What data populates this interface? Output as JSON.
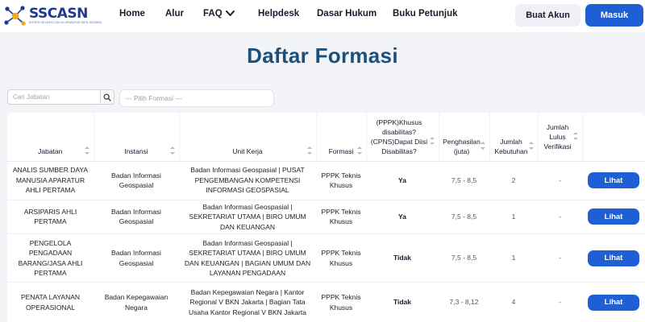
{
  "brand": {
    "name": "SSCASN",
    "tagline": "SISTEM SELEKSI CALON APARATUR SIPIL NEGARA",
    "colors": {
      "primary": "#1f5fd6",
      "title": "#1c4f7a",
      "logo": "#1f3a93",
      "accent": "#f2a81d"
    }
  },
  "nav": {
    "items": [
      "Home",
      "Alur",
      "FAQ",
      "Helpdesk",
      "Dasar Hukum",
      "Buku Petunjuk"
    ],
    "faq_icon": "chevron-down-icon",
    "buat_akun": "Buat Akun",
    "masuk": "Masuk"
  },
  "page": {
    "title": "Daftar Formasi"
  },
  "filters": {
    "search_placeholder": "Cari Jabatan",
    "search_icon": "search-icon",
    "select_placeholder": "--- Pilih Formasi ---"
  },
  "table": {
    "headers": [
      "Jabatan",
      "Instansi",
      "Unit Kerja",
      "Formasi",
      "(PPPK)Khusus disabilitas? (CPNS)Dapat Diisi Disabilitas?",
      "Penghasilan (juta)",
      "Jumlah Kebutuhan",
      "Jumlah Lulus Verifikasi",
      ""
    ],
    "rows": [
      {
        "jabatan": "ANALIS SUMBER DAYA MANUSIA APARATUR AHLI PERTAMA",
        "instansi": "Badan Informasi Geospasial",
        "unit_kerja": "Badan Informasi Geospasial | PUSAT PENGEMBANGAN KOMPETENSI INFORMASI GEOSPASIAL",
        "formasi": "PPPK Teknis Khusus",
        "disabilitas": "Ya",
        "penghasilan": "7,5 - 8,5",
        "kebutuhan": "2",
        "lulus": "-",
        "action": "Lihat"
      },
      {
        "jabatan": "ARSIPARIS AHLI PERTAMA",
        "instansi": "Badan Informasi Geospasial",
        "unit_kerja": "Badan Informasi Geospasial | SEKRETARIAT UTAMA | BIRO UMUM DAN KEUANGAN",
        "formasi": "PPPK Teknis Khusus",
        "disabilitas": "Ya",
        "penghasilan": "7,5 - 8,5",
        "kebutuhan": "1",
        "lulus": "-",
        "action": "Lihat"
      },
      {
        "jabatan": "PENGELOLA PENGADAAN BARANG/JASA AHLI PERTAMA",
        "instansi": "Badan Informasi Geospasial",
        "unit_kerja": "Badan Informasi Geospasial | SEKRETARIAT UTAMA | BIRO UMUM DAN KEUANGAN | BAGIAN UMUM DAN LAYANAN PENGADAAN",
        "formasi": "PPPK Teknis Khusus",
        "disabilitas": "Tidak",
        "penghasilan": "7,5 - 8,5",
        "kebutuhan": "1",
        "lulus": "-",
        "action": "Lihat"
      },
      {
        "jabatan": "PENATA LAYANAN OPERASIONAL",
        "instansi": "Badan Kepegawaian Negara",
        "unit_kerja": "Badan Kepegawaian Negara | Kantor Regional V BKN Jakarta | Bagian Tata Usaha Kantor Regional V BKN Jakarta",
        "formasi": "PPPK Teknis Khusus",
        "disabilitas": "Tidak",
        "penghasilan": "7,3 - 8,12",
        "kebutuhan": "4",
        "lulus": "-",
        "action": "Lihat"
      }
    ]
  }
}
